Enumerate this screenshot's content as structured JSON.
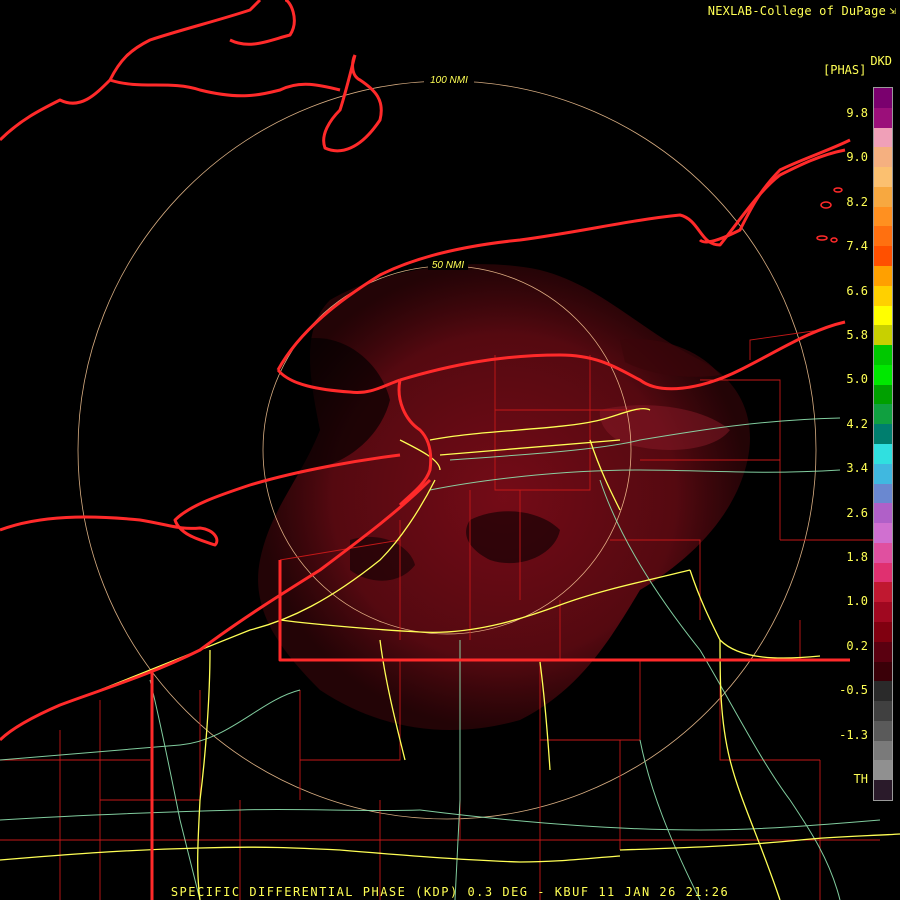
{
  "header": {
    "credit": "NEXLAB-College of DuPage",
    "credit_mark": "⇲"
  },
  "map": {
    "range_rings": [
      {
        "label": "100 NMI"
      },
      {
        "label": "50 NMI"
      }
    ],
    "colors": {
      "state_border": "#ff2a2a",
      "county_line": "#c41818",
      "interstate": "#ffff55",
      "highway": "#8fe3b0",
      "ring": "#ffcc99",
      "echo": "#6e0a14"
    }
  },
  "legend": {
    "product": "DKD",
    "units": "[PHAS]",
    "ticks": [
      "9.8",
      "9.0",
      "8.2",
      "7.4",
      "6.6",
      "5.8",
      "5.0",
      "4.2",
      "3.4",
      "2.6",
      "1.8",
      "1.0",
      "0.2",
      "-0.5",
      "-1.3",
      "TH"
    ],
    "colors": [
      "#7a006e",
      "#9b0f7a",
      "#f0a0b8",
      "#f5b080",
      "#fbc070",
      "#f7a840",
      "#ff9020",
      "#ff7010",
      "#ff5000",
      "#ffa000",
      "#ffd000",
      "#ffff00",
      "#c8d000",
      "#00c800",
      "#00e800",
      "#00a000",
      "#10a040",
      "#007e6e",
      "#30e0e0",
      "#40b8e0",
      "#6a88d0",
      "#b060c8",
      "#d070d0",
      "#e050a0",
      "#e03070",
      "#c01830",
      "#a00820",
      "#800010",
      "#5a0010",
      "#3a0008",
      "#2a2a2a",
      "#404040",
      "#5a5a5a",
      "#7a7a7a",
      "#909090",
      "#2a1a2a"
    ]
  },
  "footer": {
    "caption": "SPECIFIC DIFFERENTIAL PHASE (KDP) 0.3 DEG - KBUF 11 JAN 26 21:26"
  }
}
